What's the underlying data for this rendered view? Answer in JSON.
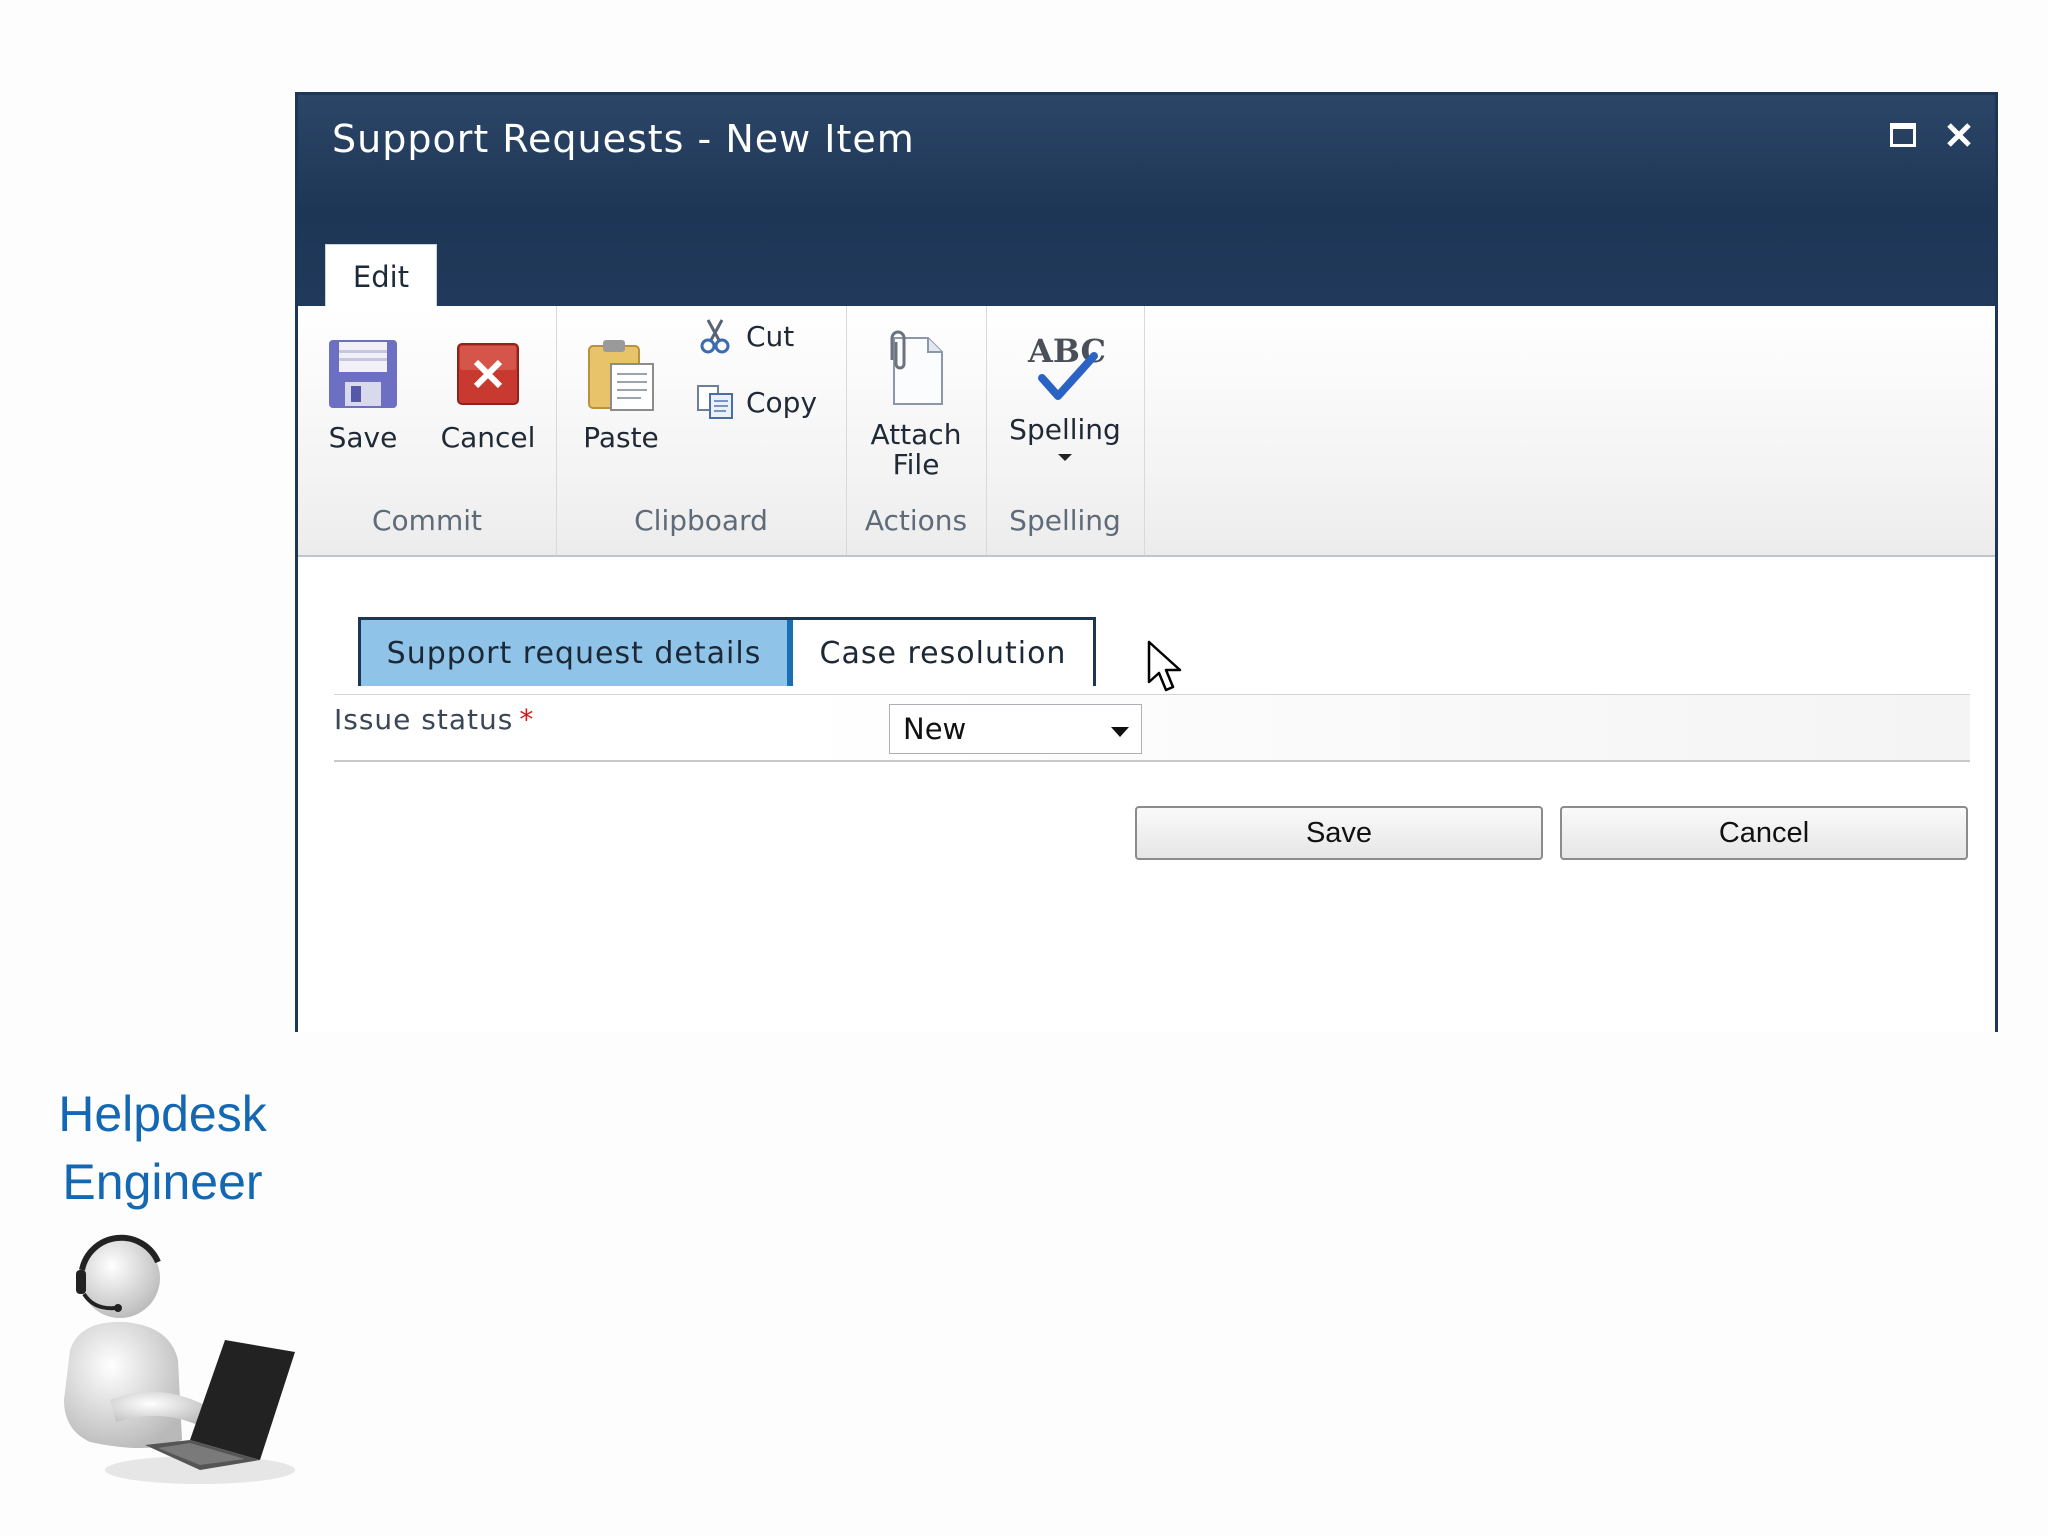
{
  "dialog": {
    "title": "Support Requests - New Item",
    "tab_edit": "Edit"
  },
  "ribbon": {
    "groups": [
      {
        "label": "Commit",
        "buttons": [
          "Save",
          "Cancel"
        ]
      },
      {
        "label": "Clipboard",
        "buttons": [
          "Paste"
        ],
        "small_buttons": [
          "Cut",
          "Copy"
        ]
      },
      {
        "label": "Actions",
        "buttons": [
          "Attach File"
        ]
      },
      {
        "label": "Spelling",
        "buttons": [
          "Spelling"
        ]
      }
    ],
    "attach_line1": "Attach",
    "attach_line2": "File",
    "spelling_icon_text": "ABC"
  },
  "form": {
    "tabs": [
      "Support request details",
      "Case resolution"
    ],
    "active_tab": "Support request details",
    "field": {
      "label": "Issue status",
      "required_mark": "*",
      "value": "New"
    },
    "save_label": "Save",
    "cancel_label": "Cancel"
  },
  "sidebar": {
    "role_line1": "Helpdesk",
    "role_line2": "Engineer"
  },
  "colors": {
    "title_bar": "#1e3656",
    "active_tab": "#8fc3e8",
    "role_text": "#1468b3",
    "required": "#d11b1b"
  },
  "icons": [
    "maximize-icon",
    "close-icon",
    "save-icon",
    "cancel-icon",
    "paste-icon",
    "cut-icon",
    "copy-icon",
    "attach-file-icon",
    "spelling-icon",
    "cursor-icon",
    "helpdesk-person-icon"
  ]
}
